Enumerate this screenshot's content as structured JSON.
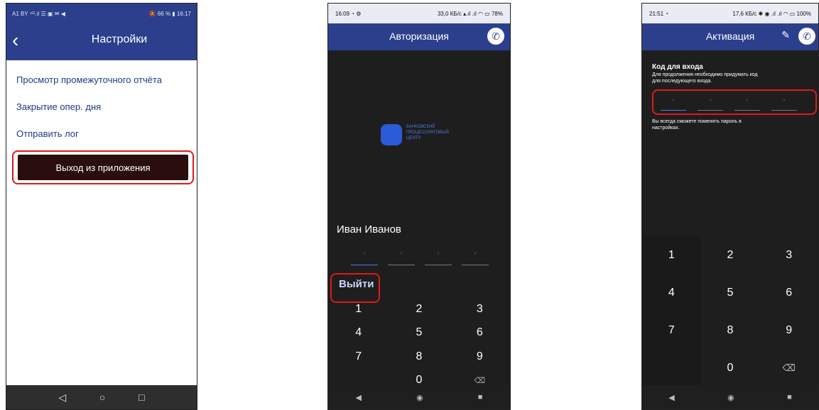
{
  "screen1": {
    "status_left": "A1 BY ⁴ᴳ.ıl ☰ ▣ ✉ ◀",
    "status_right": "🔕 66 % ▮ 16:17",
    "title": "Настройки",
    "menu": [
      "Просмотр промежуточного отчёта",
      "Закрытие опер. дня",
      "Отправить лог"
    ],
    "exit_label": "Выход из приложения",
    "nav": [
      "◁",
      "○",
      "□"
    ]
  },
  "screen2": {
    "status_left": "16:09 ◔ ⚙",
    "status_right": "33,0 КБ/с ▴.ıl .ıl ◠ ▭ 78%",
    "title": "Авторизация",
    "logo_text": [
      "БАНКОВСКИЙ",
      "ПРОЦЕССИНГОВЫЙ",
      "ЦЕНТР"
    ],
    "user_name": "Иван Иванов",
    "pin_dash": "-",
    "logout_label": "Выйти",
    "keys": [
      "1",
      "2",
      "3",
      "4",
      "5",
      "6",
      "7",
      "8",
      "9",
      "",
      "0",
      "⌫"
    ],
    "nav": [
      "◀",
      "◉",
      "■"
    ]
  },
  "screen3": {
    "status_left": "21:51 ◔",
    "status_right": "17,6 КБ/с ✱ ◉ .ıl .ıl ◠ ▭ 100%",
    "title": "Активация",
    "heading": "Код для входа",
    "desc_line1": "Для продолжения необходимо придумать код",
    "desc_line2": "для последующего входа.",
    "note_line1": "Вы всегда сможете поменять пароль в",
    "note_line2": "настройках.",
    "pin_dash": "-",
    "keys": [
      "1",
      "2",
      "3",
      "4",
      "5",
      "6",
      "7",
      "8",
      "9",
      "",
      "0",
      "⌫"
    ],
    "nav": [
      "◀",
      "◉",
      "■"
    ]
  },
  "colors": {
    "accent_blue": "#2b3f8c",
    "highlight_red": "#e01818",
    "dark_bg": "#1e1e1e"
  }
}
